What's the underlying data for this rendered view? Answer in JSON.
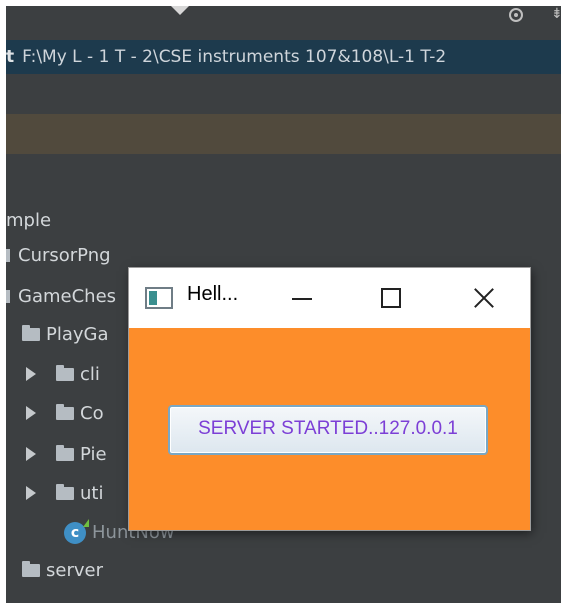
{
  "ide": {
    "path_bar": {
      "prefix": "t",
      "path": "F:\\My L - 1 T - 2\\CSE instruments 107&108\\L-1 T-2"
    },
    "project_tree": {
      "items": [
        {
          "label": "mple"
        },
        {
          "label": "CursorPng"
        },
        {
          "label": "GameChes"
        },
        {
          "label": "PlayGa"
        },
        {
          "label": "cli"
        },
        {
          "label": "Co"
        },
        {
          "label": "Pie"
        },
        {
          "label": "uti"
        },
        {
          "label": "HuntNow",
          "icon": "class-icon",
          "icon_letter": "c"
        },
        {
          "label": "server"
        }
      ]
    }
  },
  "window": {
    "title": "Hell...",
    "button_label": "SERVER STARTED..127.0.0.1",
    "colors": {
      "background": "#fd8d2a",
      "button_text": "#7c3fd6",
      "title_bar": "#ffffff"
    },
    "icons": {
      "app": "app-window-icon",
      "minimize": "minimize-icon",
      "maximize": "maximize-icon",
      "close": "close-icon"
    }
  },
  "colors": {
    "ide_background": "#3c3f41",
    "path_bar": "#1d3a4d",
    "notice_bar": "#514a3d"
  }
}
